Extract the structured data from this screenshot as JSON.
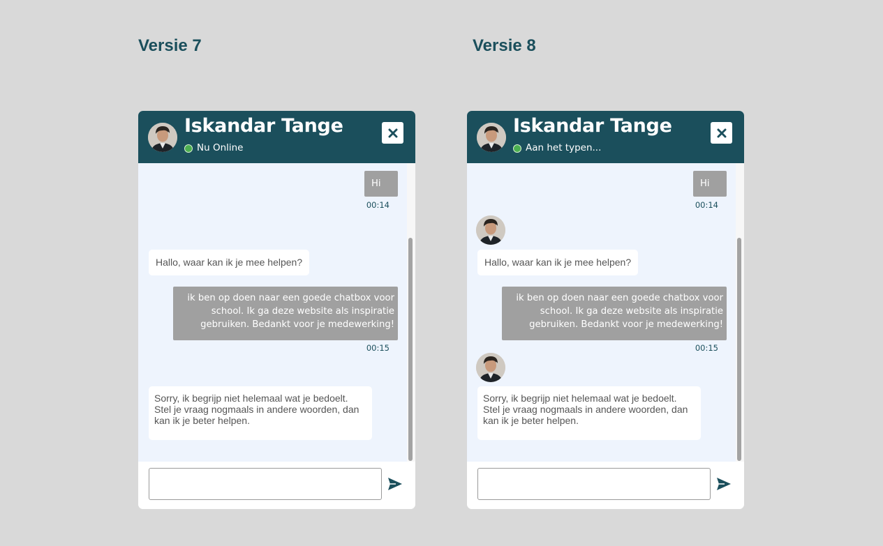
{
  "versions": [
    {
      "title": "Versie 7",
      "agent_name": "Iskandar Tange",
      "status": "Nu Online",
      "messages": {
        "user_hi": "Hi",
        "user_hi_time": "00:14",
        "agent_greeting": "Hallo, waar kan ik je mee helpen?",
        "user_long": "ik ben op doen naar een goede chatbox voor\nschool. Ik ga deze website als inspiratie\ngebruiken. Bedankt voor je medewerking!",
        "user_long_time": "00:15",
        "agent_reply": "Sorry, ik begrijp niet helemaal wat je bedoelt.\nStel je vraag nogmaals in andere woorden, dan\nkan ik je beter helpen."
      },
      "input_placeholder": ""
    },
    {
      "title": "Versie 8",
      "agent_name": "Iskandar Tange",
      "status": "Aan het typen...",
      "messages": {
        "user_hi": "Hi",
        "user_hi_time": "00:14",
        "agent_greeting": "Hallo, waar kan ik je mee helpen?",
        "user_long": "ik ben op doen naar een goede chatbox voor\nschool. Ik ga deze website als inspiratie\ngebruiken. Bedankt voor je medewerking!",
        "user_long_time": "00:15",
        "agent_reply": "Sorry, ik begrijp niet helemaal wat je bedoelt.\nStel je vraag nogmaals in andere woorden, dan\nkan ik je beter helpen."
      },
      "input_placeholder": ""
    }
  ],
  "colors": {
    "brand": "#1b4f5c",
    "background": "#d9d9d9",
    "chat_area": "#eef4fd",
    "user_bubble": "#a0a0a0",
    "online_dot": "#4caf50"
  },
  "icons": {
    "close": "close-icon",
    "send": "send-icon",
    "status": "online-status-icon",
    "avatar": "avatar"
  }
}
